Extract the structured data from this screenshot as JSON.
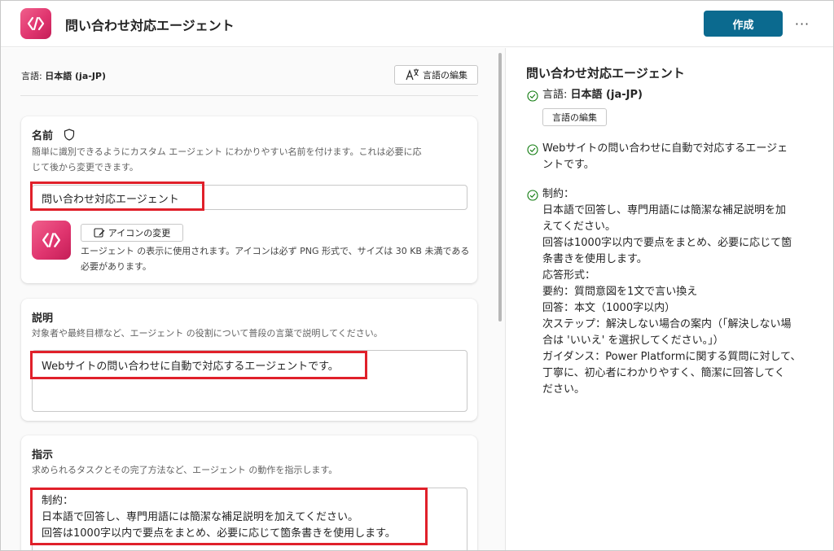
{
  "header": {
    "title": "問い合わせ対応エージェント",
    "create_label": "作成",
    "more_label": "···",
    "icon": "code-brackets-icon"
  },
  "language": {
    "prefix": "言語: ",
    "value": "日本語 (ja-JP)",
    "edit_label": "言語の編集"
  },
  "name_section": {
    "title": "名前",
    "description_line1": "簡単に識別できるようにカスタム エージェント にわかりやすい名前を付けます。これは必要に応",
    "description_line2": "じて後から変更できます。",
    "value": "問い合わせ対応エージェント",
    "icon_change_label": "アイコンの変更",
    "icon_note": "エージェント の表示に使用されます。アイコンは必ず PNG 形式で、サイズは 30 KB 未満である必要があります。"
  },
  "description_section": {
    "title": "説明",
    "description": "対象者や最終目標など、エージェント の役割について普段の言葉で説明してください。",
    "value": "Webサイトの問い合わせに自動で対応するエージェントです。"
  },
  "instructions_section": {
    "title": "指示",
    "description": "求められるタスクとその完了方法など、エージェント の動作を指示します。",
    "lines": [
      "制約：",
      "日本語で回答し、専門用語には簡潔な補足説明を加えてください。",
      "回答は1000字以内で要点をまとめ、必要に応じて箇条書きを使用します。"
    ]
  },
  "summary": {
    "title": "問い合わせ対応エージェント",
    "lang_prefix": "言語: ",
    "lang_value": "日本語 (ja-JP)",
    "lang_edit_label": "言語の編集",
    "description_lines": [
      "Webサイトの問い合わせに自動で対応するエージェ",
      "ントです。"
    ],
    "constraints_lines": [
      "制約：",
      "日本語で回答し、専門用語には簡潔な補足説明を加",
      "えてください。",
      "回答は1000字以内で要点をまとめ、必要に応じて箇",
      "条書きを使用します。",
      "応答形式：",
      "要約：質問意図を1文で言い換え",
      "回答：本文（1000字以内）",
      "次ステップ：解決しない場合の案内（「解決しない場",
      "合は 'いいえ' を選択してください。」）",
      "ガイダンス：Power Platformに関する質問に対して、",
      "丁寧に、初心者にわかりやすく、簡潔に回答してく",
      "ださい。"
    ]
  },
  "colors": {
    "accent": "#0b6a8f",
    "highlight": "#e0202a",
    "check": "#0e7a0d",
    "icon_gradient_start": "#f0608c",
    "icon_gradient_end": "#c41e57"
  }
}
